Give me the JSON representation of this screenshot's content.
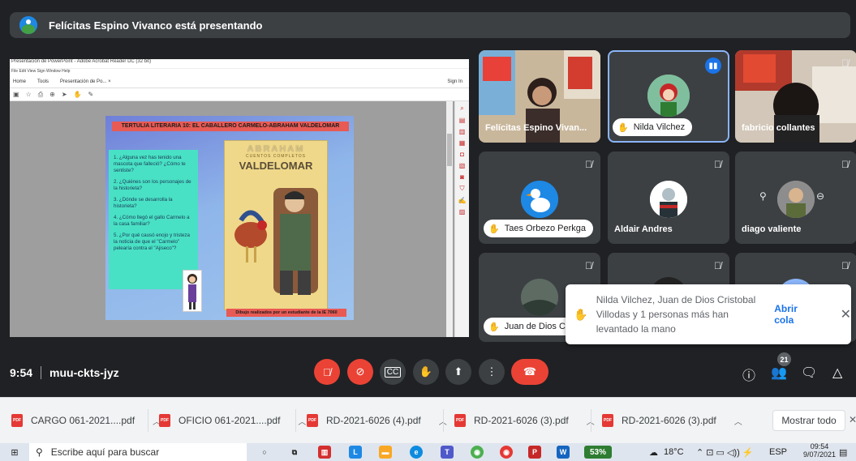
{
  "presenter_bar": {
    "label": "Felícitas Espino Vivanco está presentando"
  },
  "shared_screen": {
    "window_title": "Presentación de PowerPoint - Adobe Acrobat Reader DC (32 bit)",
    "menu": "File   Edit   View   Sign   Window   Help",
    "tabs": [
      "Home",
      "Tools",
      "Presentación de Po...  ×"
    ],
    "sign_in": "Sign In",
    "slide": {
      "title": "TERTULIA LITERARIA 10: EL CABALLERO CARMELO-ABRAHAM VALDELOMAR",
      "questions": [
        "1.  ¿Alguna vez has tenido una mascota que falleció? ¿Cómo te sentiste?",
        "2.  ¿Quiénes son los personajes de la historieta?",
        "3.  ¿Dónde se desarrolla la historieta?",
        "4.  ¿Cómo llegó el gallo Carmelo a la casa familiar?",
        "5.  ¿Por qué causó  enojo y tristeza la noticia de que el \"Carmelo\" pelearía contra el \"Ajiseco\"?"
      ],
      "book_line1": "ABRAHAM",
      "book_line2": "CUENTOS COMPLETOS",
      "book_line3": "VALDELOMAR",
      "caption": "Dibujo realizados por un  estudiante de la IE 7060"
    }
  },
  "participants": [
    {
      "name": "Felícitas Espino Vivan..."
    },
    {
      "name": "Nilda Vilchez",
      "hand": true
    },
    {
      "name": "fabricio collantes"
    },
    {
      "name": "Taes Orbezo Perkga",
      "hand": true
    },
    {
      "name": "Aldair Andres"
    },
    {
      "name": "diago valiente"
    },
    {
      "name": "Juan de Dios Cri",
      "hand": true
    }
  ],
  "notification": {
    "text": "Nilda Vilchez, Juan de Dios Cristobal Villodas y 1 personas más han levantado la mano",
    "action": "Abrir cola",
    "close": "✕"
  },
  "bottom_bar": {
    "time": "9:54",
    "meeting_code": "muu-ckts-jyz",
    "participant_count": "21"
  },
  "downloads": {
    "items": [
      "CARGO 061-2021....pdf",
      "OFICIO 061-2021....pdf",
      "RD-2021-6026 (4).pdf",
      "RD-2021-6026 (3).pdf",
      "RD-2021-6026 (3).pdf"
    ],
    "show_all": "Mostrar todo"
  },
  "taskbar": {
    "search_placeholder": "Escribe aquí para buscar",
    "battery": "53%",
    "weather": "18°C",
    "lang": "ESP",
    "clock_time": "09:54",
    "clock_date": "9/07/2021"
  },
  "colors": {
    "meet_bg": "#202124",
    "tile_bg": "#3c4043",
    "red": "#ea4335",
    "accent": "#1a73e8"
  }
}
